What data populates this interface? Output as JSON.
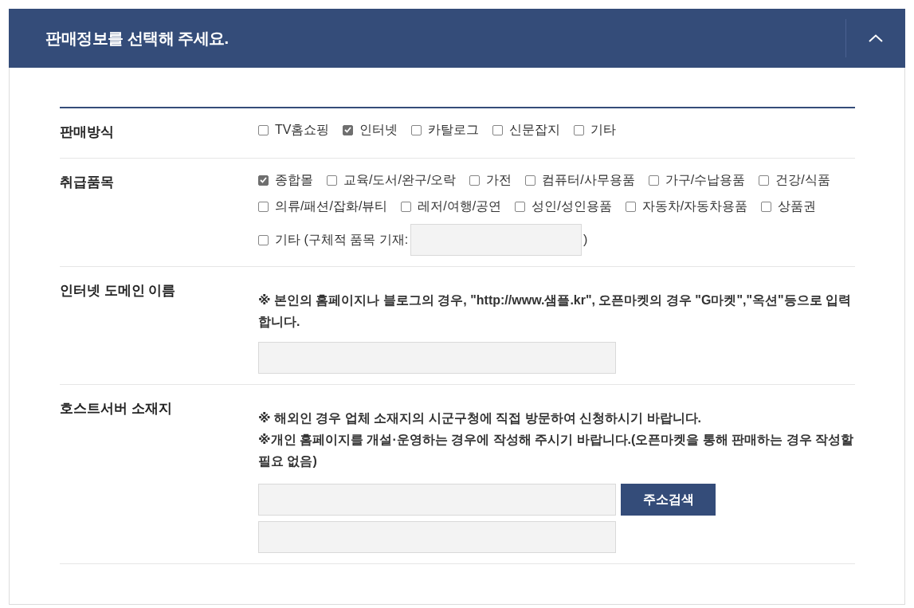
{
  "panel": {
    "title": "판매정보를 선택해 주세요.",
    "expanded": true
  },
  "rows": [
    {
      "kind": "checkboxes",
      "label": "판매방식",
      "options": [
        {
          "kind": "plain",
          "label": "TV홈쇼핑",
          "checked": false
        },
        {
          "kind": "plain",
          "label": "인터넷",
          "checked": true
        },
        {
          "kind": "plain",
          "label": "카탈로그",
          "checked": false
        },
        {
          "kind": "plain",
          "label": "신문잡지",
          "checked": false
        },
        {
          "kind": "plain",
          "label": "기타",
          "checked": false
        }
      ]
    },
    {
      "kind": "checkboxes",
      "label": "취급품목",
      "options": [
        {
          "kind": "plain",
          "label": "종합몰",
          "checked": true
        },
        {
          "kind": "plain",
          "label": "교육/도서/완구/오락",
          "checked": false
        },
        {
          "kind": "plain",
          "label": "가전",
          "checked": false
        },
        {
          "kind": "plain",
          "label": "컴퓨터/사무용품",
          "checked": false
        },
        {
          "kind": "plain",
          "label": "가구/수납용품",
          "checked": false
        },
        {
          "kind": "plain",
          "label": "건강/식품",
          "checked": false
        },
        {
          "kind": "plain",
          "label": "의류/패션/잡화/뷰티",
          "checked": false
        },
        {
          "kind": "plain",
          "label": "레저/여행/공연",
          "checked": false
        },
        {
          "kind": "plain",
          "label": "성인/성인용품",
          "checked": false
        },
        {
          "kind": "plain",
          "label": "자동차/자동차용품",
          "checked": false
        },
        {
          "kind": "plain",
          "label": "상품권",
          "checked": false
        },
        {
          "kind": "with_input",
          "label": "기타 (구체적 품목 기재:",
          "suffix": ")",
          "checked": false
        }
      ]
    },
    {
      "kind": "text_input",
      "label": "인터넷 도메인 이름",
      "notes": [
        "※ 본인의 홈페이지나 블로그의 경우, \"http://www.샘플.kr\", 오픈마켓의 경우 \"G마켓\",\"옥션\"등으로 입력합니다."
      ]
    },
    {
      "kind": "address",
      "label": "호스트서버 소재지",
      "notes": [
        "※ 해외인 경우 업체 소재지의 시군구청에 직접 방문하여 신청하시기 바랍니다.",
        "※개인 홈페이지를 개설·운영하는 경우에 작성해 주시기 바랍니다.(오픈마켓을 통해 판매하는 경우 작성할 필요 없음)"
      ],
      "button": "주소검색"
    }
  ]
}
